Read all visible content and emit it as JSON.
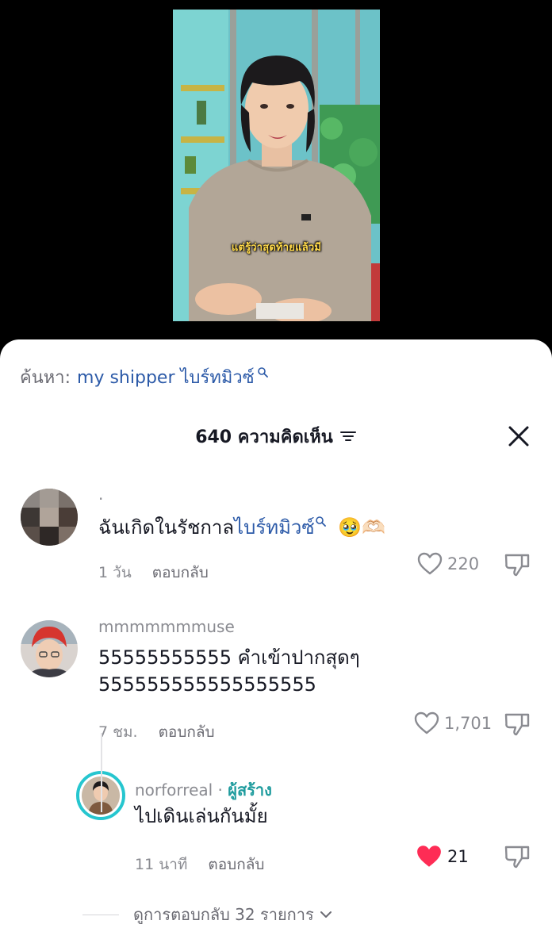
{
  "video": {
    "caption": "แต่รู้ว่าสุดท้ายแล้วมี"
  },
  "search": {
    "label": "ค้นหา:",
    "term": "my shipper ไบร์ทมิวซ์"
  },
  "header": {
    "count": "640",
    "title_suffix": "ความคิดเห็น"
  },
  "comments": [
    {
      "username": "·",
      "text_prefix": "ฉันเกิดในรัชกาล",
      "text_highlight": "ไบร์ทมิวซ์",
      "emoji": "🥹🫶🏻",
      "time": "1 วัน",
      "reply_label": "ตอบกลับ",
      "likes": "220"
    },
    {
      "username": "mmmmmmmuse",
      "text_line1": "55555555555 คำเข้าปากสุดๆ",
      "text_line2": "555555555555555555",
      "time": "7 ชม.",
      "reply_label": "ตอบกลับ",
      "likes": "1,701"
    },
    {
      "username": "norforreal",
      "separator": "·",
      "creator_badge": "ผู้สร้าง",
      "text": "ไปเดินเล่นกันมั้ย",
      "time": "11 นาที",
      "reply_label": "ตอบกลับ",
      "likes": "21",
      "liked": true
    }
  ],
  "view_replies": "ดูการตอบกลับ 32 รายการ",
  "colors": {
    "accent_link": "#2c5aa8",
    "creator": "#1f9c9e",
    "liked_heart": "#fe2c55",
    "caption": "#ffd94a"
  },
  "icons": [
    "search-icon",
    "filter-icon",
    "close-icon",
    "heart-icon",
    "thumbs-down-icon",
    "chevron-down-icon"
  ]
}
